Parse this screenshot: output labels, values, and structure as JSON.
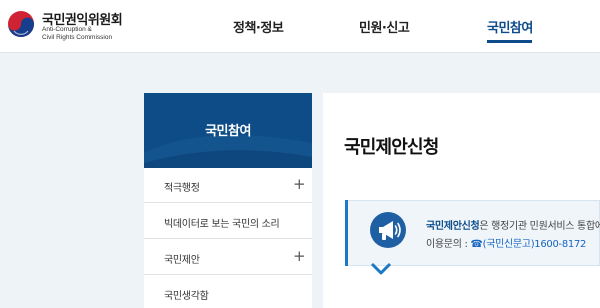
{
  "header": {
    "logo": {
      "title": "국민권익위원회",
      "subtitle_line1": "Anti-Corruption &",
      "subtitle_line2": "Civil Rights Commission"
    },
    "nav": [
      {
        "label": "정책·정보",
        "active": false
      },
      {
        "label": "민원·신고",
        "active": false
      },
      {
        "label": "국민참여",
        "active": true
      }
    ]
  },
  "sidebar": {
    "title": "국민참여",
    "items": [
      {
        "label": "적극행정",
        "expandable": true,
        "toggle": "+"
      },
      {
        "label": "빅데이터로 보는 국민의 소리",
        "expandable": false
      },
      {
        "label": "국민제안",
        "expandable": true,
        "toggle": "+"
      },
      {
        "label": "국민생각함",
        "expandable": false
      }
    ]
  },
  "main": {
    "page_title": "국민제안신청",
    "notice": {
      "highlight": "국민제안신청",
      "text_rest": "은 행정기관 민원서비스 통합에",
      "contact_label": "이용문의 : ",
      "contact_phone": "☎(국민신문고)1600-8172"
    }
  },
  "colors": {
    "brand_navy": "#0c4c8a",
    "sidebar_header": "#0d4c86",
    "page_bg": "#eef3f8",
    "notice_accent": "#1c79c6",
    "phone_link": "#1565c0"
  },
  "icons": {
    "logo": "taegeuk-emblem-icon",
    "expand": "plus-icon",
    "notice": "megaphone-icon"
  }
}
